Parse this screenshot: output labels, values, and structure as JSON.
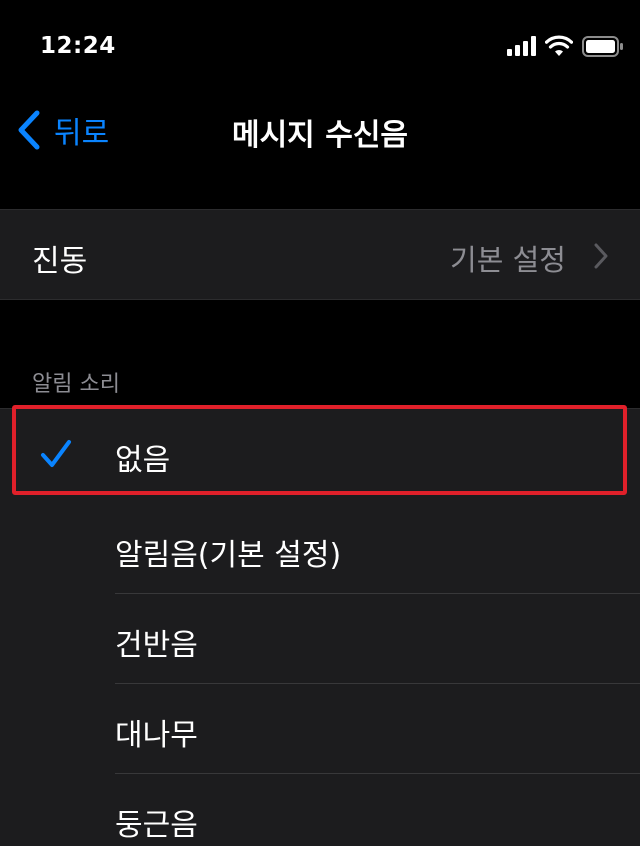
{
  "status_bar": {
    "time": "12:24"
  },
  "nav": {
    "back_label": "뒤로",
    "title": "메시지 수신음"
  },
  "vibration": {
    "label": "진동",
    "value": "기본 설정"
  },
  "alert_section": {
    "header": "알림 소리"
  },
  "sounds": [
    {
      "label": "없음",
      "selected": true
    },
    {
      "label": "알림음(기본 설정)",
      "selected": false
    },
    {
      "label": "건반음",
      "selected": false
    },
    {
      "label": "대나무",
      "selected": false
    },
    {
      "label": "둥근음",
      "selected": false
    }
  ],
  "colors": {
    "accent": "#0A84FF",
    "background": "#000000",
    "cell": "#1c1c1e",
    "secondary_text": "#8d8d93",
    "highlight": "#e0202a"
  }
}
